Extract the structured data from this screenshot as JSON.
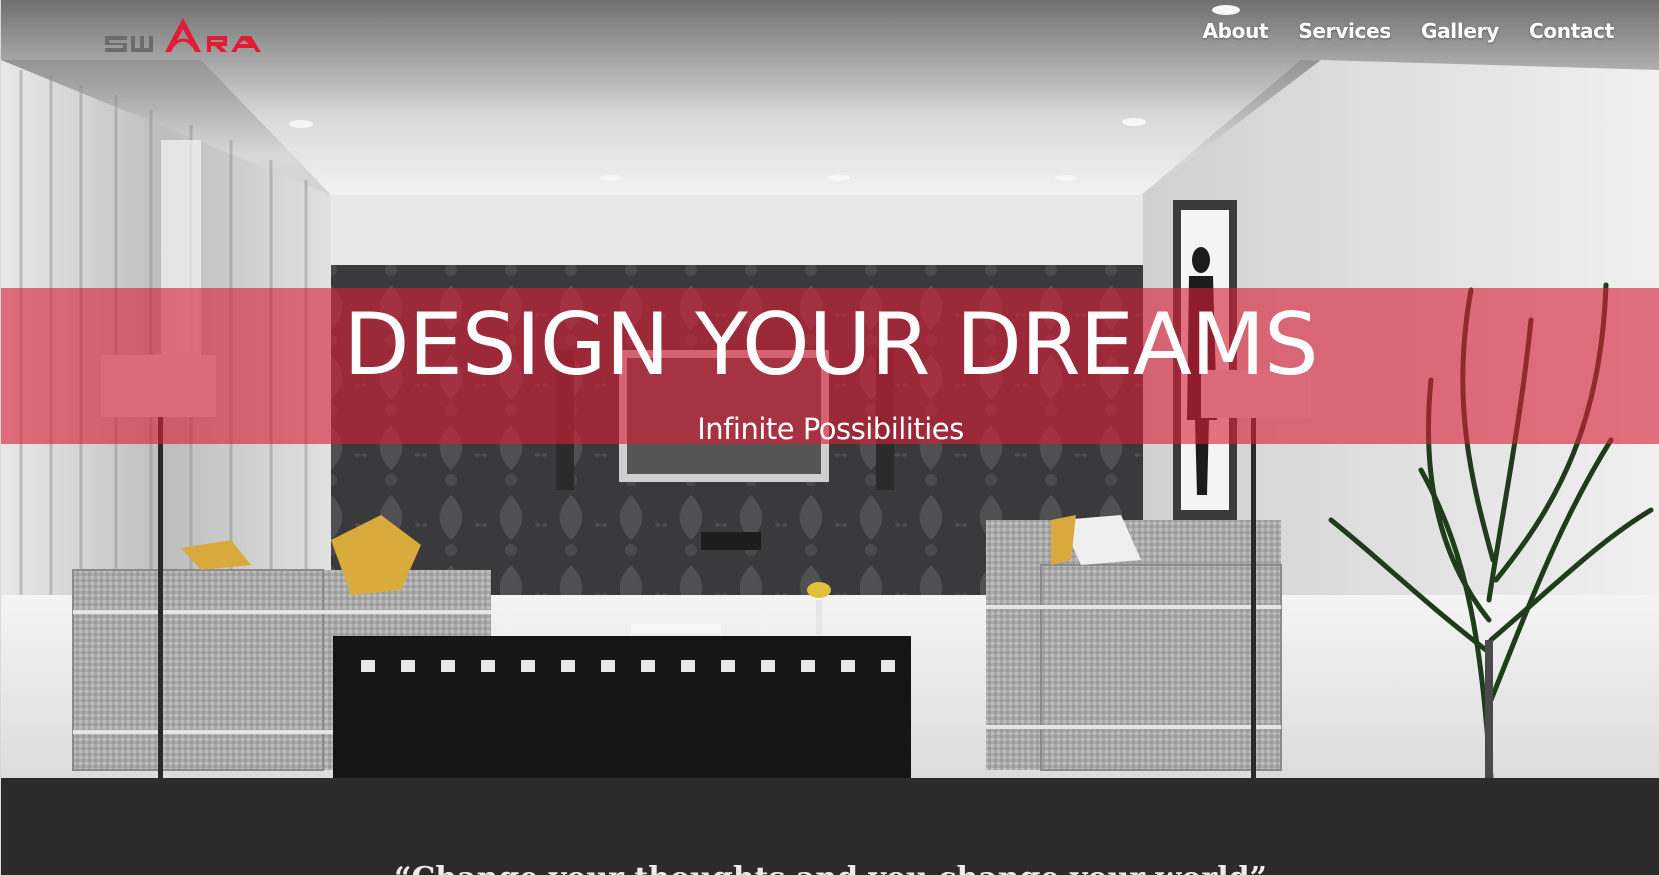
{
  "header": {
    "logo_text": "SWARA",
    "nav": [
      {
        "label": "About"
      },
      {
        "label": "Services"
      },
      {
        "label": "Gallery"
      },
      {
        "label": "Contact"
      }
    ]
  },
  "hero": {
    "title": "DESIGN YOUR DREAMS",
    "subtitle": "Infinite Possibilities"
  },
  "quote": {
    "text": "“Change your thoughts and you change your world”"
  },
  "colors": {
    "accent": "#d61e37",
    "logo_grey": "#6b6b6b",
    "dark_strip": "#2b2b2b"
  }
}
